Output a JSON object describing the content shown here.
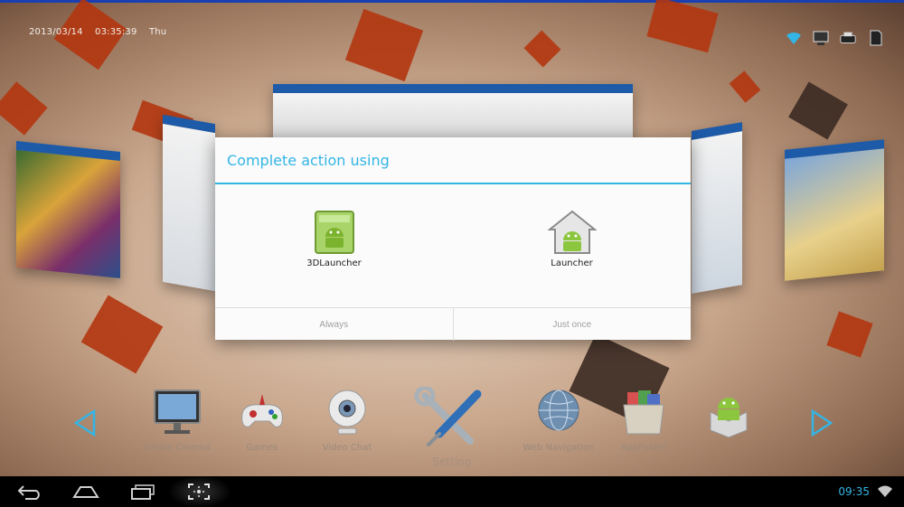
{
  "status_bar": {
    "date": "2013/03/14",
    "time": "03:35:39",
    "day": "Thu",
    "icons": [
      "wifi-icon",
      "network-icon",
      "usb-icon",
      "sdcard-icon"
    ]
  },
  "dialog": {
    "title": "Complete action using",
    "options": [
      {
        "label": "3DLauncher",
        "icon": "android-box-icon"
      },
      {
        "label": "Launcher",
        "icon": "android-home-icon"
      }
    ],
    "buttons": {
      "always": "Always",
      "just_once": "Just once"
    }
  },
  "dock": {
    "items": [
      {
        "label": "Online Cinema",
        "icon": "monitor-icon"
      },
      {
        "label": "Games",
        "icon": "gamepad-icon"
      },
      {
        "label": "Video Chat",
        "icon": "webcam-icon"
      },
      {
        "label": "Setting",
        "icon": "tools-icon"
      },
      {
        "label": "Web Navigation",
        "icon": "globe-icon"
      },
      {
        "label": "AppFolder",
        "icon": "folder-icon"
      },
      {
        "label": "",
        "icon": "android-market-icon"
      }
    ]
  },
  "navbar": {
    "clock": "09:35",
    "buttons": [
      "back-icon",
      "home-icon",
      "recent-apps-icon",
      "screenshot-icon"
    ]
  },
  "colors": {
    "accent": "#33b5e5",
    "panel_top": "#1d5aa8",
    "shard": "#b3360f"
  }
}
